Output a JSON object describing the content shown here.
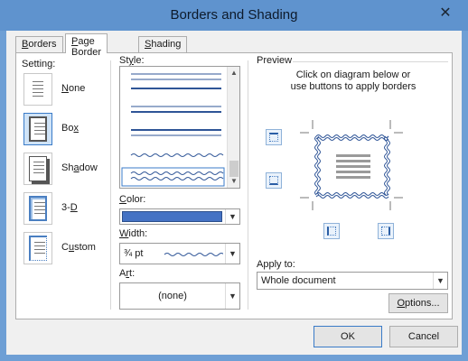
{
  "window": {
    "title": "Borders and Shading",
    "close_glyph": "✕"
  },
  "tabs": [
    {
      "label": "Borders",
      "mnemonic": "B",
      "rest": "orders"
    },
    {
      "label": "Page Border",
      "mnemonic": "P",
      "rest": "age Border"
    },
    {
      "label": "Shading",
      "mnemonic": "S",
      "rest": "hading"
    }
  ],
  "setting": {
    "label": "Setting:",
    "items": [
      {
        "label": "None",
        "mnemonic": "N",
        "rest": "one",
        "icon": "page-none-icon",
        "selected": false
      },
      {
        "label": "Box",
        "mnemonic": "x",
        "pre": "Bo",
        "icon": "page-box-icon",
        "selected": true
      },
      {
        "label": "Shadow",
        "mnemonic": "a",
        "pre": "Sh",
        "rest": "dow",
        "icon": "page-shadow-icon",
        "selected": false
      },
      {
        "label": "3-D",
        "mnemonic": "D",
        "pre": "3-",
        "icon": "page-3d-icon",
        "selected": false
      },
      {
        "label": "Custom",
        "mnemonic": "u",
        "pre": "C",
        "rest": "stom",
        "icon": "page-custom-icon",
        "selected": false
      }
    ]
  },
  "style": {
    "label": "Style:",
    "mnemonic": "y",
    "pre": "St",
    "rest": "le:",
    "selected_index": 6
  },
  "color": {
    "label": "Color:",
    "mnemonic": "C",
    "rest": "olor:",
    "value_hex": "#4472c4"
  },
  "width": {
    "label": "Width:",
    "mnemonic": "W",
    "rest": "idth:",
    "value": "¾ pt"
  },
  "art": {
    "label": "Art:",
    "mnemonic": "r",
    "pre": "A",
    "rest": "t:",
    "value": "(none)"
  },
  "preview": {
    "label": "Preview",
    "instructions_line1": "Click on diagram below or",
    "instructions_line2": "use buttons to apply borders"
  },
  "apply_to": {
    "label": "Apply to:",
    "mnemonic": "L",
    "value": "Whole document"
  },
  "buttons": {
    "options": {
      "label": "Options...",
      "mnemonic": "O",
      "rest": "ptions..."
    },
    "ok": "OK",
    "cancel": "Cancel"
  }
}
